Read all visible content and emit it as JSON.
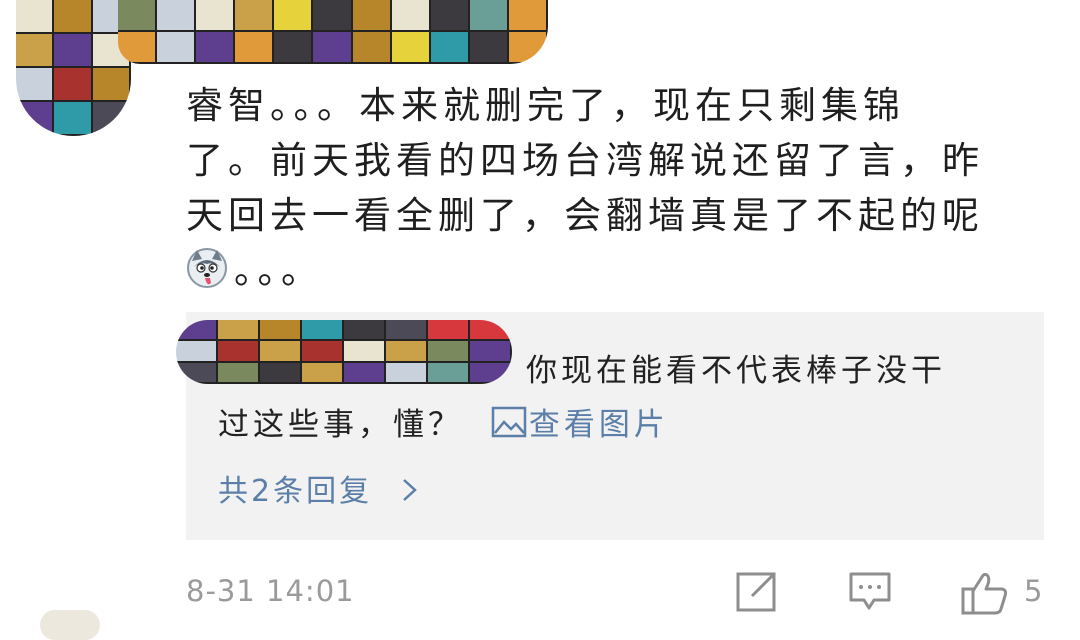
{
  "comment": {
    "text_line1": "睿智。。。本来就删完了，现在只剩集锦",
    "text_line2": "了。前天我看的四场台湾解说还留了言，昨",
    "text_line3": "天回去一看全删了，会翻墙真是了不起的呢",
    "text_tail": "。。。",
    "emoji": "husky-dog-emoji",
    "timestamp": "8-31  14:01",
    "like_count": "5"
  },
  "reply": {
    "text_line1": "你现在能看不代表棒子没干",
    "text_line2": "过这些事，懂？",
    "view_image_label": "查看图片",
    "total_replies_label": "共2条回复"
  },
  "icons": {
    "share": "share-icon",
    "comment": "comment-icon",
    "like": "thumbs-up-icon",
    "image": "image-icon",
    "chevron": "chevron-right-icon"
  },
  "colors": {
    "link": "#5b7fa8",
    "reply_bg": "#f2f2f2",
    "meta_gray": "#9a9a9a"
  }
}
